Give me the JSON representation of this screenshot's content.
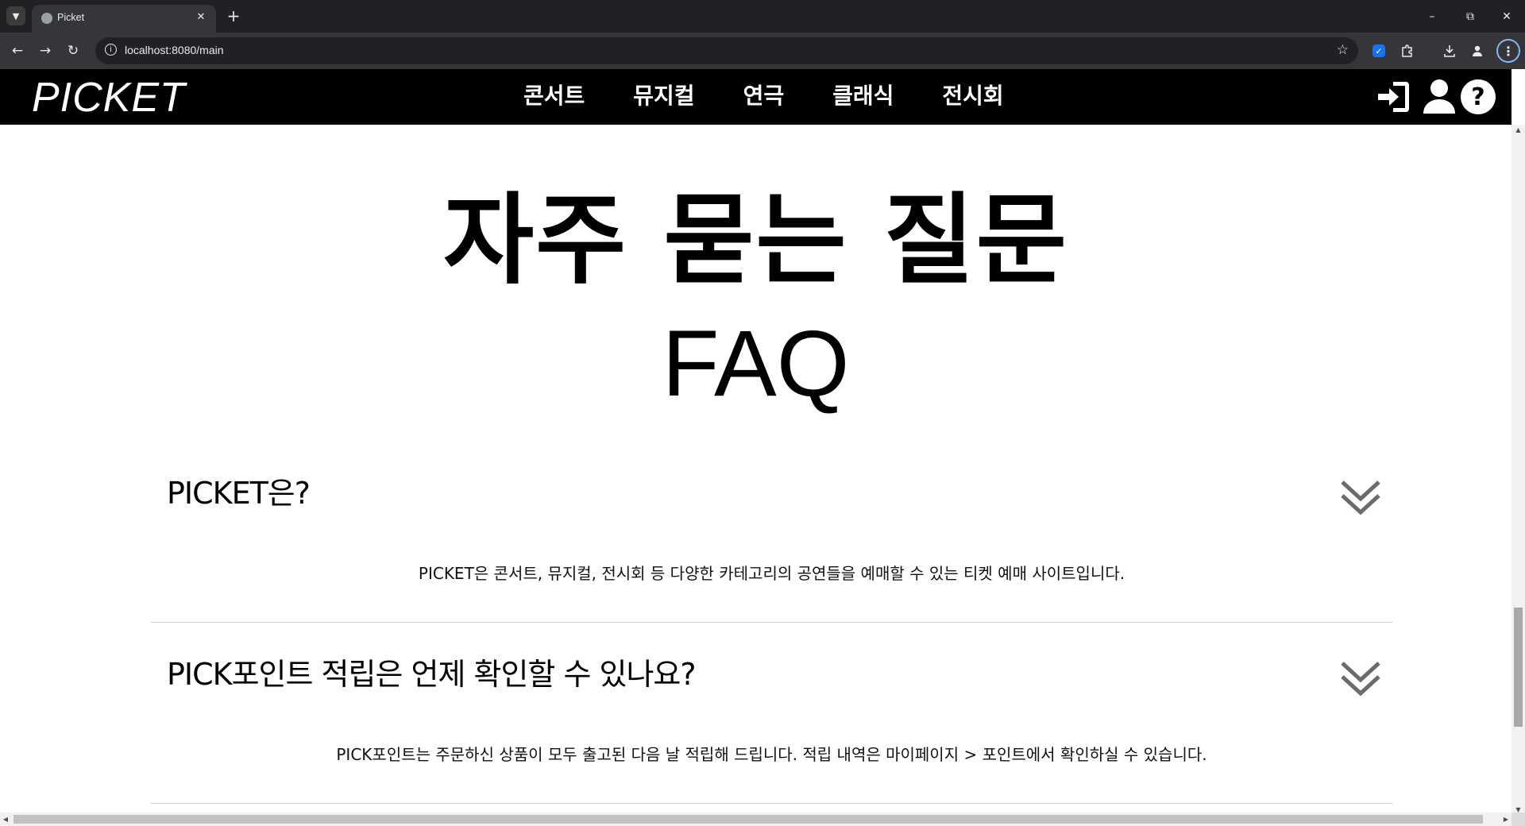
{
  "browser": {
    "tab_title": "Picket",
    "url": "localhost:8080/main",
    "icons": [
      "tab-list-icon",
      "favicon-icon",
      "close-icon",
      "plus-icon",
      "minimize-icon",
      "restore-icon",
      "window-close-icon",
      "back-icon",
      "forward-icon",
      "reload-icon",
      "info-icon",
      "star-icon",
      "extension-icon",
      "puzzle-icon",
      "download-icon",
      "profile-icon",
      "menu-icon"
    ]
  },
  "header": {
    "logo": "PICKET",
    "nav": [
      "콘서트",
      "뮤지컬",
      "연극",
      "클래식",
      "전시회"
    ],
    "icons": [
      "login-icon",
      "user-icon",
      "help-icon"
    ]
  },
  "page": {
    "title_ko": "자주 묻는 질문",
    "title_en": "FAQ"
  },
  "faq": [
    {
      "question": "PICKET은?",
      "answer": "PICKET은 콘서트, 뮤지컬, 전시회 등 다양한 카테고리의 공연들을 예매할 수 있는 티켓 예매 사이트입니다."
    },
    {
      "question": "PICK포인트 적립은 언제 확인할 수 있나요?",
      "answer": "PICK포인트는 주문하신 상품이 모두 출고된 다음 날 적립해 드립니다. 적립 내역은 마이페이지 > 포인트에서 확인하실 수 있습니다."
    }
  ],
  "colors": {
    "header_bg": "#000000",
    "chrome_bg": "#202124",
    "toolbar_bg": "#35363a",
    "toggle_icon": "#6b6b6b"
  }
}
